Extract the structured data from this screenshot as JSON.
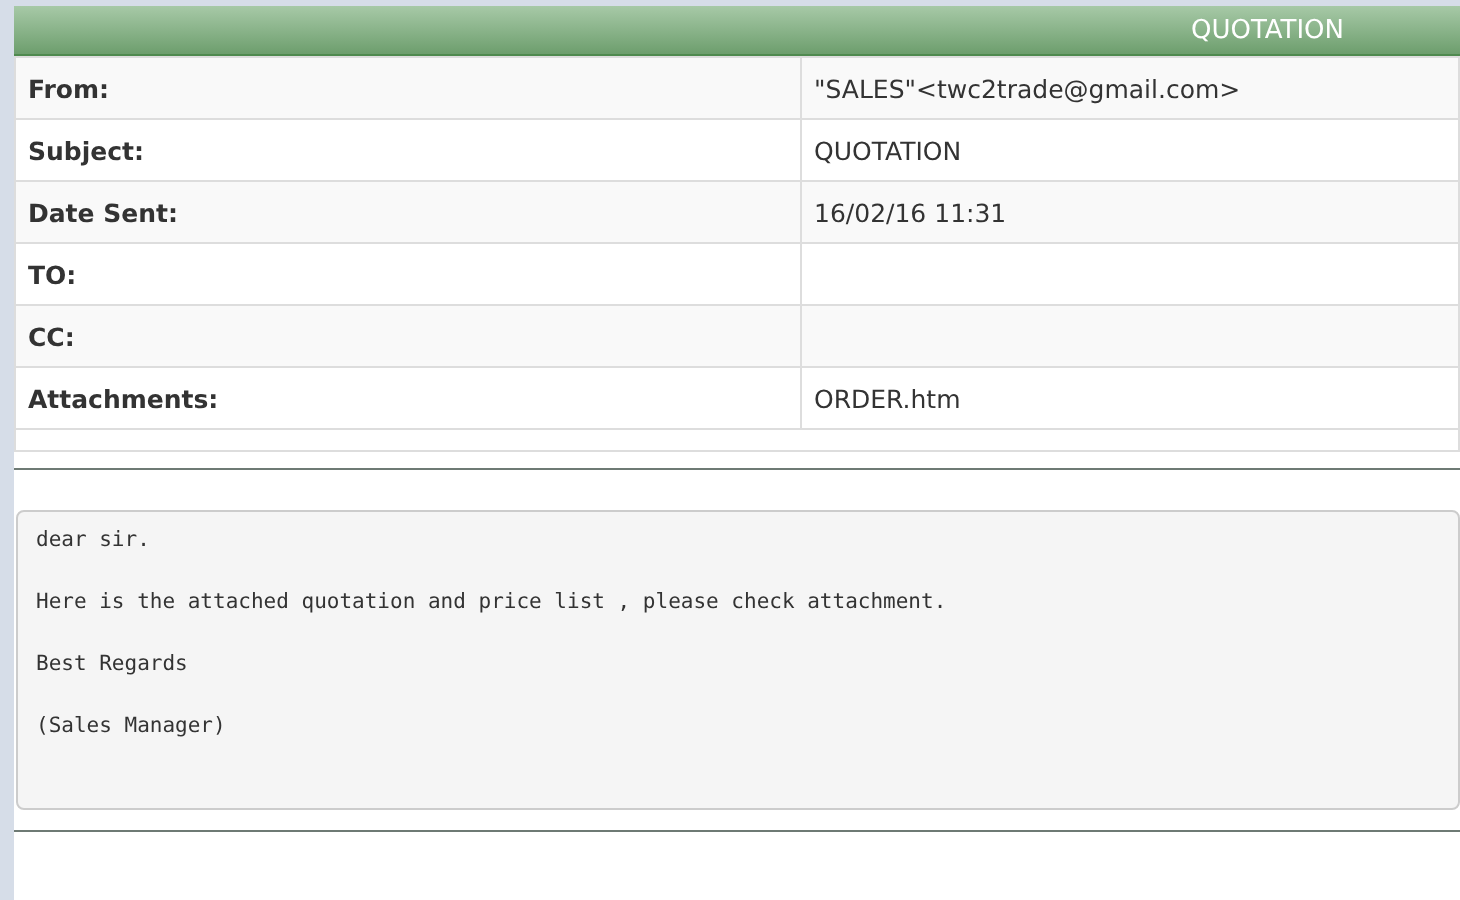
{
  "header": {
    "title": "QUOTATION"
  },
  "fields": [
    {
      "label": "From:",
      "value": "\"SALES\"<twc2trade@gmail.com>"
    },
    {
      "label": "Subject:",
      "value": "QUOTATION"
    },
    {
      "label": "Date Sent:",
      "value": "16/02/16 11:31"
    },
    {
      "label": "TO:"
    },
    {
      "label": "CC:"
    },
    {
      "label": "Attachments:",
      "value": "ORDER.htm"
    }
  ],
  "body": [
    "dear sir.",
    "Here is the attached quotation and price list , please check attachment.",
    "Best Regards",
    "(Sales Manager)"
  ]
}
